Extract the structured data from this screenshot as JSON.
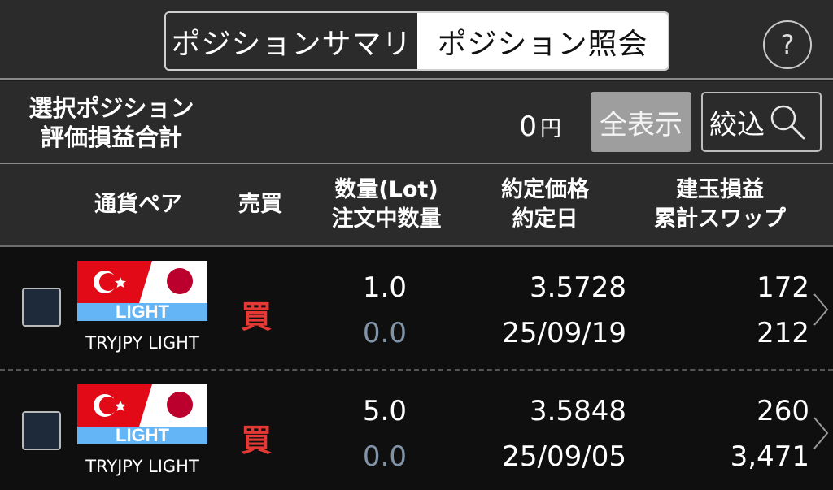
{
  "tabs": {
    "summary_label": "ポジションサマリ",
    "inquiry_label": "ポジション照会"
  },
  "help_label": "?",
  "summary": {
    "label_line1": "選択ポジション",
    "label_line2": "評価損益合計",
    "value": "0",
    "unit": "円",
    "show_all_label": "全表示",
    "filter_label": "絞込"
  },
  "columns": {
    "pair": "通貨ペア",
    "side": "売買",
    "qty_line1": "数量(Lot)",
    "qty_line2": "注文中数量",
    "price_line1": "約定価格",
    "price_line2": "約定日",
    "pl_line1": "建玉損益",
    "pl_line2": "累計スワップ"
  },
  "positions": [
    {
      "flag_text": "LIGHT",
      "pair": "TRYJPY LIGHT",
      "side": "買",
      "quantity": "1.0",
      "order_quantity": "0.0",
      "price": "3.5728",
      "date": "25/09/19",
      "pl": "172",
      "swap": "212"
    },
    {
      "flag_text": "LIGHT",
      "pair": "TRYJPY LIGHT",
      "side": "買",
      "quantity": "5.0",
      "order_quantity": "0.0",
      "price": "3.5848",
      "date": "25/09/05",
      "pl": "260",
      "swap": "3,471"
    }
  ],
  "colors": {
    "turkey_red": "#e30a17",
    "japan_red": "#bc002d",
    "light_band": "#64b5f6",
    "buy_red": "#e53935"
  },
  "icons": [
    "help-icon",
    "search-icon",
    "chevron-right-icon",
    "turkey-flag-icon",
    "japan-flag-icon"
  ]
}
